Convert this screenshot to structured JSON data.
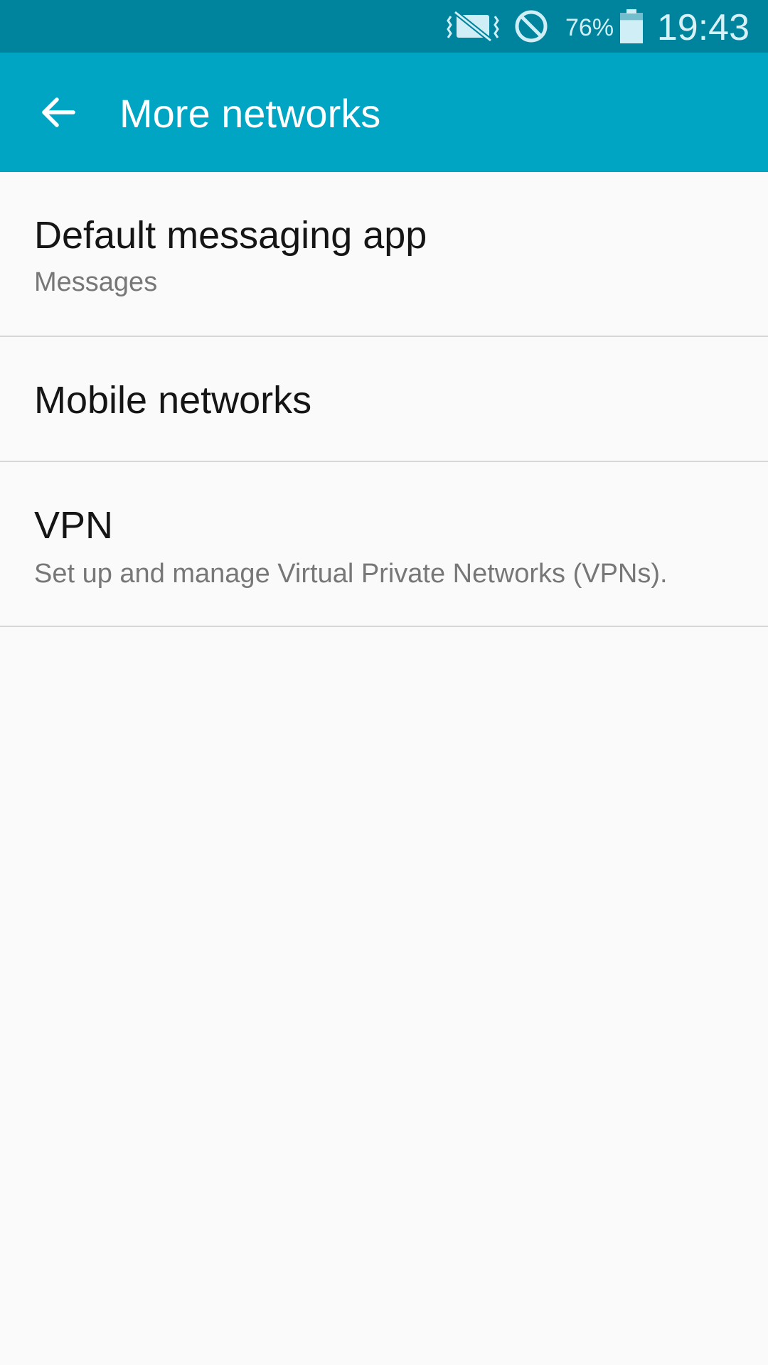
{
  "status_bar": {
    "icons": [
      "vibrate-mute-icon",
      "do-not-disturb-icon",
      "battery-icon"
    ],
    "battery_percent": "76%",
    "battery_level": 0.76,
    "time": "19:43",
    "background_color": "#00839c"
  },
  "app_bar": {
    "back_icon": "arrow-back-icon",
    "title": "More networks",
    "background_color": "#00a5c4"
  },
  "list": {
    "items": [
      {
        "title": "Default messaging app",
        "subtitle": "Messages"
      },
      {
        "title": "Mobile networks"
      },
      {
        "title": "VPN",
        "subtitle": "Set up and manage Virtual Private Networks (VPNs)."
      }
    ]
  }
}
